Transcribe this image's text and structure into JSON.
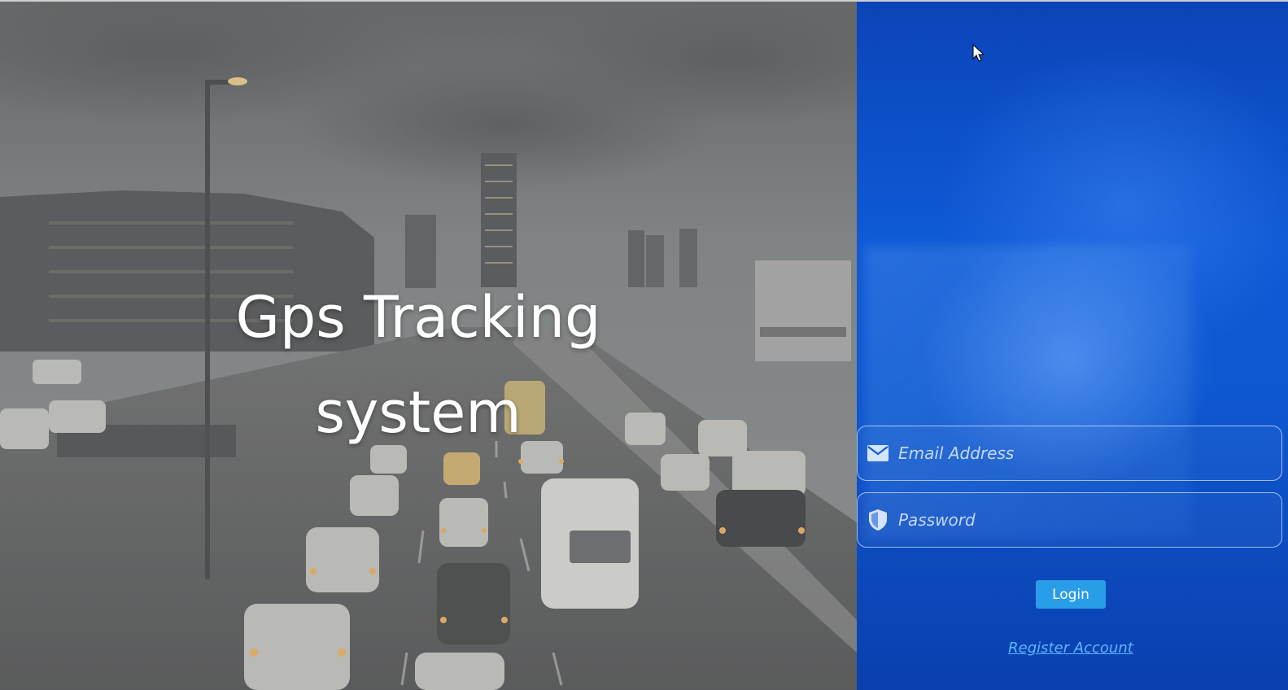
{
  "hero": {
    "title_line1": "Gps Tracking",
    "title_line2": "system",
    "image": "city-traffic-photo"
  },
  "login": {
    "email_placeholder": "Email Address",
    "email_value": "",
    "email_icon": "envelope-icon",
    "password_placeholder": "Password",
    "password_value": "",
    "password_icon": "shield-icon",
    "login_label": "Login",
    "register_label": "Register Account"
  },
  "colors": {
    "panel_blue": "#0f5ad6",
    "button_blue": "#2a9de8",
    "link_blue": "#5cb6ff",
    "hero_overlay": "#6a6c6d"
  }
}
